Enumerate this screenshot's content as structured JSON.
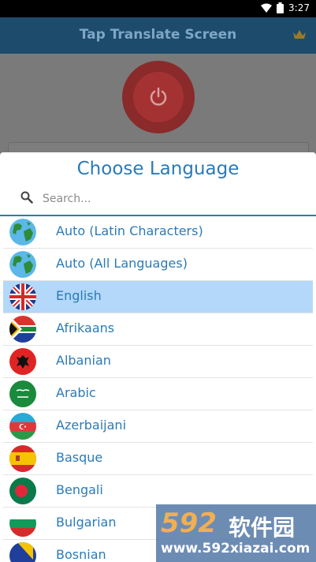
{
  "status_bar": {
    "time": "3:27"
  },
  "app": {
    "title": "Tap Translate Screen"
  },
  "dialog": {
    "title": "Choose Language",
    "search_placeholder": "Search...",
    "languages": [
      {
        "label": "Auto (Latin Characters)",
        "flag": "globe-icon"
      },
      {
        "label": "Auto (All Languages)",
        "flag": "globe-icon"
      },
      {
        "label": "English",
        "flag": "uk-flag-icon",
        "selected": true
      },
      {
        "label": "Afrikaans",
        "flag": "south-africa-flag-icon"
      },
      {
        "label": "Albanian",
        "flag": "albania-flag-icon"
      },
      {
        "label": "Arabic",
        "flag": "saudi-flag-icon"
      },
      {
        "label": "Azerbaijani",
        "flag": "azerbaijan-flag-icon"
      },
      {
        "label": "Basque",
        "flag": "spain-flag-icon"
      },
      {
        "label": "Bengali",
        "flag": "bangladesh-flag-icon"
      },
      {
        "label": "Bulgarian",
        "flag": "bulgaria-flag-icon"
      },
      {
        "label": "Bosnian",
        "flag": "bosnia-flag-icon"
      }
    ]
  },
  "watermark": {
    "logo": "592",
    "cn": "软件园",
    "url": "www.592xiazai.com"
  },
  "colors": {
    "accent": "#2b7ab7",
    "selected_row": "#b3d8f9",
    "appbar": "#1d4b6c"
  }
}
